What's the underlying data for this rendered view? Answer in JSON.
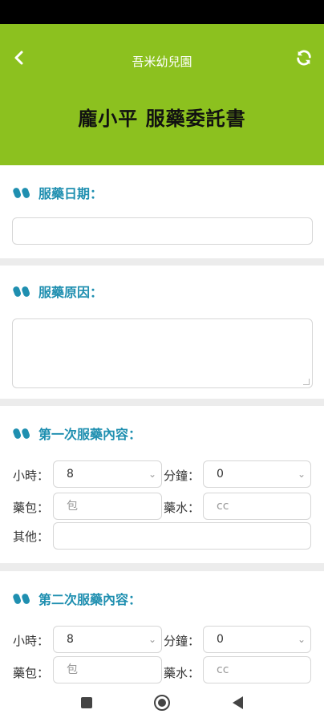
{
  "header": {
    "app_title": "吾米幼兒園",
    "page_title": "龐小平 服藥委託書",
    "back_icon": "chevron-left-icon",
    "refresh_icon": "refresh-icon",
    "accent_color": "#8cc11f"
  },
  "sections": {
    "date": {
      "label": "服藥日期：",
      "value": ""
    },
    "reason": {
      "label": "服藥原因：",
      "value": ""
    },
    "first": {
      "label": "第一次服藥內容：",
      "hour_label": "小時：",
      "hour_value": "8",
      "minute_label": "分鐘：",
      "minute_value": "0",
      "packet_label": "藥包：",
      "packet_placeholder": "包",
      "liquid_label": "藥水：",
      "liquid_placeholder": "cc",
      "other_label": "其他：",
      "other_value": ""
    },
    "second": {
      "label": "第二次服藥內容：",
      "hour_label": "小時：",
      "hour_value": "8",
      "minute_label": "分鐘：",
      "minute_value": "0",
      "packet_label": "藥包：",
      "packet_placeholder": "包",
      "liquid_label": "藥水：",
      "liquid_placeholder": "cc"
    }
  },
  "label_color": "#1f8fb0",
  "nav": {
    "icons": [
      "recent-apps-icon",
      "home-icon",
      "back-icon"
    ]
  }
}
